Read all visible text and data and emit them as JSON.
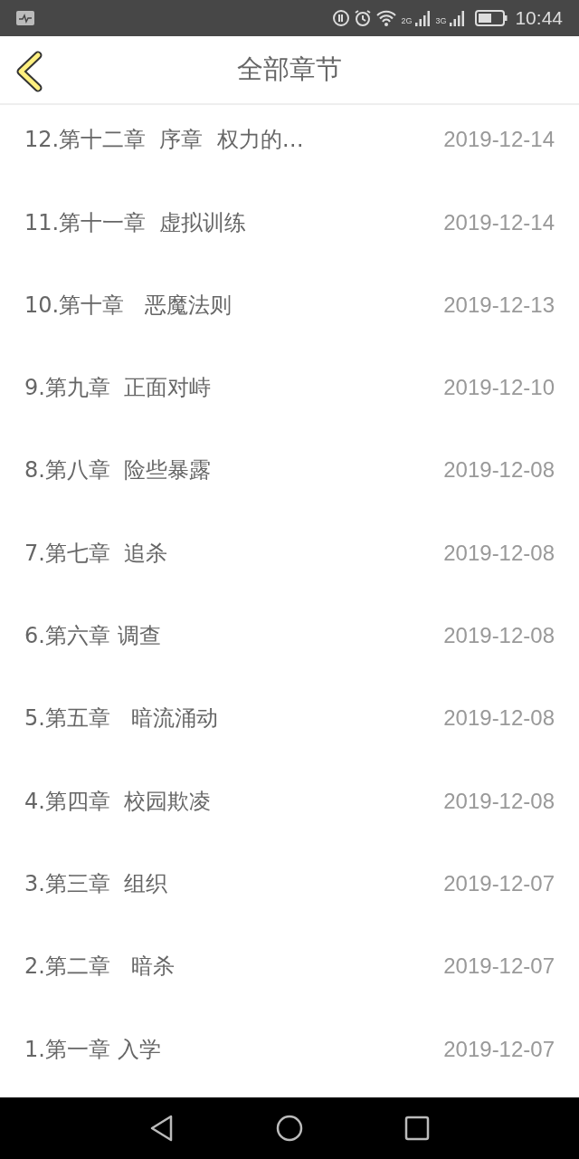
{
  "status_bar": {
    "network_labels": [
      "2G",
      "3G"
    ],
    "time": "10:44"
  },
  "header": {
    "title": "全部章节"
  },
  "chapters": [
    {
      "title": "12.第十二章  序章  权力的…",
      "date": "2019-12-14"
    },
    {
      "title": "11.第十一章  虚拟训练",
      "date": "2019-12-14"
    },
    {
      "title": "10.第十章   恶魔法则",
      "date": "2019-12-13"
    },
    {
      "title": "9.第九章  正面对峙",
      "date": "2019-12-10"
    },
    {
      "title": "8.第八章  险些暴露",
      "date": "2019-12-08"
    },
    {
      "title": "7.第七章  追杀",
      "date": "2019-12-08"
    },
    {
      "title": "6.第六章 调查",
      "date": "2019-12-08"
    },
    {
      "title": "5.第五章   暗流涌动",
      "date": "2019-12-08"
    },
    {
      "title": "4.第四章  校园欺凌",
      "date": "2019-12-08"
    },
    {
      "title": "3.第三章  组织",
      "date": "2019-12-07"
    },
    {
      "title": "2.第二章   暗杀",
      "date": "2019-12-07"
    },
    {
      "title": "1.第一章 入学",
      "date": "2019-12-07"
    }
  ]
}
